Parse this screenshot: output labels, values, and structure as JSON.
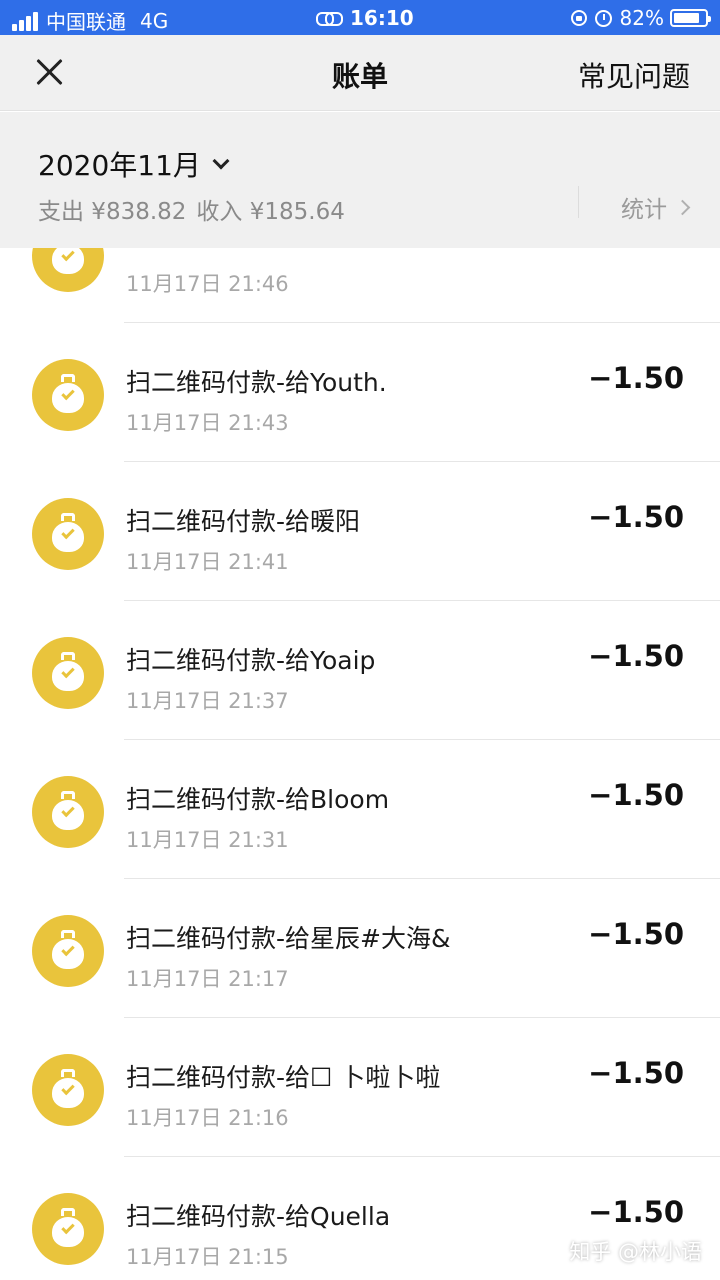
{
  "status_bar": {
    "carrier": "中国联通",
    "network": "4G",
    "time": "16:10",
    "battery": "82%",
    "battery_level": 0.82
  },
  "nav": {
    "title": "账单",
    "faq_label": "常见问题"
  },
  "summary": {
    "month": "2020年11月",
    "expense": "支出 ¥838.82",
    "income": "收入 ¥185.64",
    "stats_label": "统计"
  },
  "colors": {
    "status_bar_bg": "#2f6ee8",
    "icon_yellow": "#e9c43c",
    "header_bg": "#f0f0f0"
  },
  "transactions": [
    {
      "title": "",
      "time": "11月17日 21:46",
      "amount": "",
      "icon": "money-bag-icon"
    },
    {
      "title": "扫二维码付款-给Youth.",
      "time": "11月17日 21:43",
      "amount": "−1.50",
      "icon": "money-bag-icon"
    },
    {
      "title": "扫二维码付款-给暖阳",
      "time": "11月17日 21:41",
      "amount": "−1.50",
      "icon": "money-bag-icon"
    },
    {
      "title": "扫二维码付款-给Yoaip",
      "time": "11月17日 21:37",
      "amount": "−1.50",
      "icon": "money-bag-icon"
    },
    {
      "title": "扫二维码付款-给Bloom",
      "time": "11月17日 21:31",
      "amount": "−1.50",
      "icon": "money-bag-icon"
    },
    {
      "title": "扫二维码付款-给星辰#大海&",
      "time": "11月17日 21:17",
      "amount": "−1.50",
      "icon": "money-bag-icon"
    },
    {
      "title": "扫二维码付款-给☐ 卜啦卜啦",
      "time": "11月17日 21:16",
      "amount": "−1.50",
      "icon": "money-bag-icon"
    },
    {
      "title": "扫二维码付款-给Quella",
      "time": "11月17日 21:15",
      "amount": "−1.50",
      "icon": "money-bag-icon"
    }
  ],
  "watermark": "知乎 @林小语"
}
